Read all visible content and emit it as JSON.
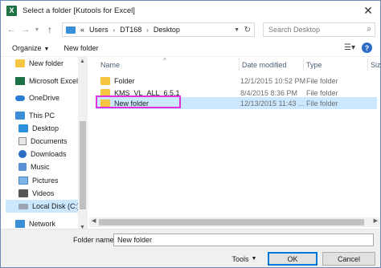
{
  "window": {
    "title": "Select a folder [Kutools for Excel]",
    "app_icon_letter": "X"
  },
  "address": {
    "prefix": "«",
    "segments": [
      "Users",
      "DT168",
      "Desktop"
    ],
    "separator": "›"
  },
  "search": {
    "placeholder": "Search Desktop"
  },
  "toolbar": {
    "organize_label": "Organize",
    "new_folder_label": "New folder"
  },
  "nav": {
    "items": [
      {
        "label": "New folder",
        "icon": "folder-icon"
      },
      {
        "label": "Microsoft Excel",
        "icon": "excel-icon"
      },
      {
        "label": "OneDrive",
        "icon": "onedrive-icon"
      },
      {
        "label": "This PC",
        "icon": "pc-icon"
      },
      {
        "label": "Desktop",
        "icon": "desktop-icon"
      },
      {
        "label": "Documents",
        "icon": "documents-icon"
      },
      {
        "label": "Downloads",
        "icon": "downloads-icon"
      },
      {
        "label": "Music",
        "icon": "music-icon"
      },
      {
        "label": "Pictures",
        "icon": "pictures-icon"
      },
      {
        "label": "Videos",
        "icon": "videos-icon"
      },
      {
        "label": "Local Disk (C:)",
        "icon": "disk-icon"
      },
      {
        "label": "Network",
        "icon": "network-icon"
      }
    ],
    "selected": "Local Disk (C:)"
  },
  "columns": {
    "name": "Name",
    "date": "Date modified",
    "type": "Type",
    "size": "Size"
  },
  "files": [
    {
      "name": "Folder",
      "date": "12/1/2015 10:52 PM",
      "type": "File folder"
    },
    {
      "name": "KMS_VL_ALL_6.5.1",
      "date": "8/4/2015 8:36 PM",
      "type": "File folder"
    },
    {
      "name": "New folder",
      "date": "12/13/2015 11:43 ...",
      "type": "File folder"
    }
  ],
  "selected_file": "New folder",
  "highlight_color": "#e030e0",
  "bottom": {
    "folder_name_label": "Folder name:",
    "folder_name_value": "New folder",
    "tools_label": "Tools",
    "ok_label": "OK",
    "cancel_label": "Cancel"
  }
}
